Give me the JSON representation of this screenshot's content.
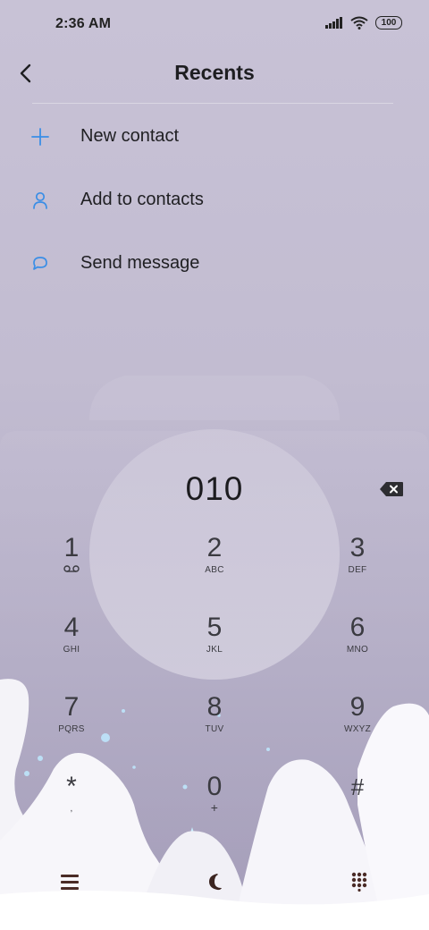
{
  "status_bar": {
    "time": "2:36 AM",
    "battery": "100",
    "icons": [
      "signal-icon",
      "wifi-icon",
      "battery-icon"
    ]
  },
  "header": {
    "title": "Recents",
    "back_icon": "back-arrow-icon"
  },
  "actions": [
    {
      "label": "New contact",
      "icon": "plus-icon"
    },
    {
      "label": "Add to contacts",
      "icon": "person-icon"
    },
    {
      "label": "Send message",
      "icon": "message-bubble-icon"
    }
  ],
  "dialer": {
    "number": "010",
    "backspace_icon": "backspace-icon"
  },
  "keypad": [
    {
      "digit": "1",
      "letters": "",
      "sub_icon": "voicemail-icon"
    },
    {
      "digit": "2",
      "letters": "ABC"
    },
    {
      "digit": "3",
      "letters": "DEF"
    },
    {
      "digit": "4",
      "letters": "GHI"
    },
    {
      "digit": "5",
      "letters": "JKL"
    },
    {
      "digit": "6",
      "letters": "MNO"
    },
    {
      "digit": "7",
      "letters": "PQRS"
    },
    {
      "digit": "8",
      "letters": "TUV"
    },
    {
      "digit": "9",
      "letters": "WXYZ"
    },
    {
      "digit": "*",
      "letters": ","
    },
    {
      "digit": "0",
      "letters": "+"
    },
    {
      "digit": "#",
      "letters": ""
    }
  ],
  "bottom_bar": {
    "icons": [
      "menu-icon",
      "moon-icon",
      "dialpad-icon"
    ]
  },
  "colors": {
    "accent": "#3a8ee6",
    "background_top": "#c8c2d6",
    "background_bottom": "#a49db9",
    "text": "#1f1f22"
  }
}
